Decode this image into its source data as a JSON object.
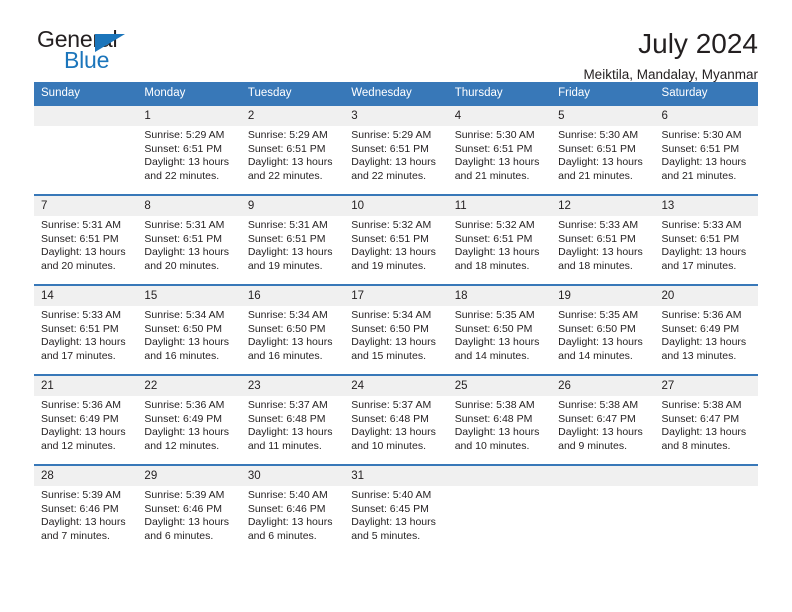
{
  "brand": {
    "name_top": "General",
    "name_bottom": "Blue",
    "accent_color": "#1b75bb"
  },
  "header": {
    "title": "July 2024",
    "subtitle": "Meiktila, Mandalay, Myanmar"
  },
  "calendar": {
    "header_bg": "#3878b8",
    "daynum_bg": "#f0f0f0",
    "weekday_labels": [
      "Sunday",
      "Monday",
      "Tuesday",
      "Wednesday",
      "Thursday",
      "Friday",
      "Saturday"
    ],
    "weeks": [
      [
        {
          "day": "",
          "sunrise": "",
          "sunset": "",
          "daylight_line1": "",
          "daylight_line2": ""
        },
        {
          "day": "1",
          "sunrise": "Sunrise: 5:29 AM",
          "sunset": "Sunset: 6:51 PM",
          "daylight_line1": "Daylight: 13 hours",
          "daylight_line2": "and 22 minutes."
        },
        {
          "day": "2",
          "sunrise": "Sunrise: 5:29 AM",
          "sunset": "Sunset: 6:51 PM",
          "daylight_line1": "Daylight: 13 hours",
          "daylight_line2": "and 22 minutes."
        },
        {
          "day": "3",
          "sunrise": "Sunrise: 5:29 AM",
          "sunset": "Sunset: 6:51 PM",
          "daylight_line1": "Daylight: 13 hours",
          "daylight_line2": "and 22 minutes."
        },
        {
          "day": "4",
          "sunrise": "Sunrise: 5:30 AM",
          "sunset": "Sunset: 6:51 PM",
          "daylight_line1": "Daylight: 13 hours",
          "daylight_line2": "and 21 minutes."
        },
        {
          "day": "5",
          "sunrise": "Sunrise: 5:30 AM",
          "sunset": "Sunset: 6:51 PM",
          "daylight_line1": "Daylight: 13 hours",
          "daylight_line2": "and 21 minutes."
        },
        {
          "day": "6",
          "sunrise": "Sunrise: 5:30 AM",
          "sunset": "Sunset: 6:51 PM",
          "daylight_line1": "Daylight: 13 hours",
          "daylight_line2": "and 21 minutes."
        }
      ],
      [
        {
          "day": "7",
          "sunrise": "Sunrise: 5:31 AM",
          "sunset": "Sunset: 6:51 PM",
          "daylight_line1": "Daylight: 13 hours",
          "daylight_line2": "and 20 minutes."
        },
        {
          "day": "8",
          "sunrise": "Sunrise: 5:31 AM",
          "sunset": "Sunset: 6:51 PM",
          "daylight_line1": "Daylight: 13 hours",
          "daylight_line2": "and 20 minutes."
        },
        {
          "day": "9",
          "sunrise": "Sunrise: 5:31 AM",
          "sunset": "Sunset: 6:51 PM",
          "daylight_line1": "Daylight: 13 hours",
          "daylight_line2": "and 19 minutes."
        },
        {
          "day": "10",
          "sunrise": "Sunrise: 5:32 AM",
          "sunset": "Sunset: 6:51 PM",
          "daylight_line1": "Daylight: 13 hours",
          "daylight_line2": "and 19 minutes."
        },
        {
          "day": "11",
          "sunrise": "Sunrise: 5:32 AM",
          "sunset": "Sunset: 6:51 PM",
          "daylight_line1": "Daylight: 13 hours",
          "daylight_line2": "and 18 minutes."
        },
        {
          "day": "12",
          "sunrise": "Sunrise: 5:33 AM",
          "sunset": "Sunset: 6:51 PM",
          "daylight_line1": "Daylight: 13 hours",
          "daylight_line2": "and 18 minutes."
        },
        {
          "day": "13",
          "sunrise": "Sunrise: 5:33 AM",
          "sunset": "Sunset: 6:51 PM",
          "daylight_line1": "Daylight: 13 hours",
          "daylight_line2": "and 17 minutes."
        }
      ],
      [
        {
          "day": "14",
          "sunrise": "Sunrise: 5:33 AM",
          "sunset": "Sunset: 6:51 PM",
          "daylight_line1": "Daylight: 13 hours",
          "daylight_line2": "and 17 minutes."
        },
        {
          "day": "15",
          "sunrise": "Sunrise: 5:34 AM",
          "sunset": "Sunset: 6:50 PM",
          "daylight_line1": "Daylight: 13 hours",
          "daylight_line2": "and 16 minutes."
        },
        {
          "day": "16",
          "sunrise": "Sunrise: 5:34 AM",
          "sunset": "Sunset: 6:50 PM",
          "daylight_line1": "Daylight: 13 hours",
          "daylight_line2": "and 16 minutes."
        },
        {
          "day": "17",
          "sunrise": "Sunrise: 5:34 AM",
          "sunset": "Sunset: 6:50 PM",
          "daylight_line1": "Daylight: 13 hours",
          "daylight_line2": "and 15 minutes."
        },
        {
          "day": "18",
          "sunrise": "Sunrise: 5:35 AM",
          "sunset": "Sunset: 6:50 PM",
          "daylight_line1": "Daylight: 13 hours",
          "daylight_line2": "and 14 minutes."
        },
        {
          "day": "19",
          "sunrise": "Sunrise: 5:35 AM",
          "sunset": "Sunset: 6:50 PM",
          "daylight_line1": "Daylight: 13 hours",
          "daylight_line2": "and 14 minutes."
        },
        {
          "day": "20",
          "sunrise": "Sunrise: 5:36 AM",
          "sunset": "Sunset: 6:49 PM",
          "daylight_line1": "Daylight: 13 hours",
          "daylight_line2": "and 13 minutes."
        }
      ],
      [
        {
          "day": "21",
          "sunrise": "Sunrise: 5:36 AM",
          "sunset": "Sunset: 6:49 PM",
          "daylight_line1": "Daylight: 13 hours",
          "daylight_line2": "and 12 minutes."
        },
        {
          "day": "22",
          "sunrise": "Sunrise: 5:36 AM",
          "sunset": "Sunset: 6:49 PM",
          "daylight_line1": "Daylight: 13 hours",
          "daylight_line2": "and 12 minutes."
        },
        {
          "day": "23",
          "sunrise": "Sunrise: 5:37 AM",
          "sunset": "Sunset: 6:48 PM",
          "daylight_line1": "Daylight: 13 hours",
          "daylight_line2": "and 11 minutes."
        },
        {
          "day": "24",
          "sunrise": "Sunrise: 5:37 AM",
          "sunset": "Sunset: 6:48 PM",
          "daylight_line1": "Daylight: 13 hours",
          "daylight_line2": "and 10 minutes."
        },
        {
          "day": "25",
          "sunrise": "Sunrise: 5:38 AM",
          "sunset": "Sunset: 6:48 PM",
          "daylight_line1": "Daylight: 13 hours",
          "daylight_line2": "and 10 minutes."
        },
        {
          "day": "26",
          "sunrise": "Sunrise: 5:38 AM",
          "sunset": "Sunset: 6:47 PM",
          "daylight_line1": "Daylight: 13 hours",
          "daylight_line2": "and 9 minutes."
        },
        {
          "day": "27",
          "sunrise": "Sunrise: 5:38 AM",
          "sunset": "Sunset: 6:47 PM",
          "daylight_line1": "Daylight: 13 hours",
          "daylight_line2": "and 8 minutes."
        }
      ],
      [
        {
          "day": "28",
          "sunrise": "Sunrise: 5:39 AM",
          "sunset": "Sunset: 6:46 PM",
          "daylight_line1": "Daylight: 13 hours",
          "daylight_line2": "and 7 minutes."
        },
        {
          "day": "29",
          "sunrise": "Sunrise: 5:39 AM",
          "sunset": "Sunset: 6:46 PM",
          "daylight_line1": "Daylight: 13 hours",
          "daylight_line2": "and 6 minutes."
        },
        {
          "day": "30",
          "sunrise": "Sunrise: 5:40 AM",
          "sunset": "Sunset: 6:46 PM",
          "daylight_line1": "Daylight: 13 hours",
          "daylight_line2": "and 6 minutes."
        },
        {
          "day": "31",
          "sunrise": "Sunrise: 5:40 AM",
          "sunset": "Sunset: 6:45 PM",
          "daylight_line1": "Daylight: 13 hours",
          "daylight_line2": "and 5 minutes."
        },
        {
          "day": "",
          "sunrise": "",
          "sunset": "",
          "daylight_line1": "",
          "daylight_line2": ""
        },
        {
          "day": "",
          "sunrise": "",
          "sunset": "",
          "daylight_line1": "",
          "daylight_line2": ""
        },
        {
          "day": "",
          "sunrise": "",
          "sunset": "",
          "daylight_line1": "",
          "daylight_line2": ""
        }
      ]
    ]
  }
}
